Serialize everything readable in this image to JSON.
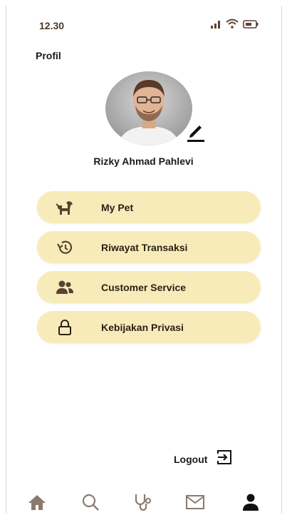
{
  "status_bar": {
    "time": "12.30",
    "icons": [
      "signal-icon",
      "wifi-icon",
      "battery-icon"
    ]
  },
  "header": {
    "title": "Profil"
  },
  "profile": {
    "name": "Rizky Ahmad Pahlevi",
    "avatar_icon": "user-avatar",
    "edit_icon": "edit-pencil-icon"
  },
  "menu": {
    "items": [
      {
        "label": "My Pet",
        "icon": "pet-icon"
      },
      {
        "label": "Riwayat Transaksi",
        "icon": "history-icon"
      },
      {
        "label": "Customer Service",
        "icon": "people-icon"
      },
      {
        "label": "Kebijakan Privasi",
        "icon": "lock-icon"
      }
    ]
  },
  "logout": {
    "label": "Logout",
    "icon": "logout-icon"
  },
  "bottom_nav": {
    "items": [
      {
        "icon": "home-icon",
        "active": false
      },
      {
        "icon": "search-icon",
        "active": false
      },
      {
        "icon": "stethoscope-icon",
        "active": false
      },
      {
        "icon": "mail-icon",
        "active": false
      },
      {
        "icon": "profile-icon",
        "active": true
      }
    ]
  },
  "colors": {
    "menu_bg": "#f7ecb9",
    "icon_brown": "#5b4033",
    "nav_inactive": "#8a7a70",
    "nav_active": "#1a1a1a"
  }
}
